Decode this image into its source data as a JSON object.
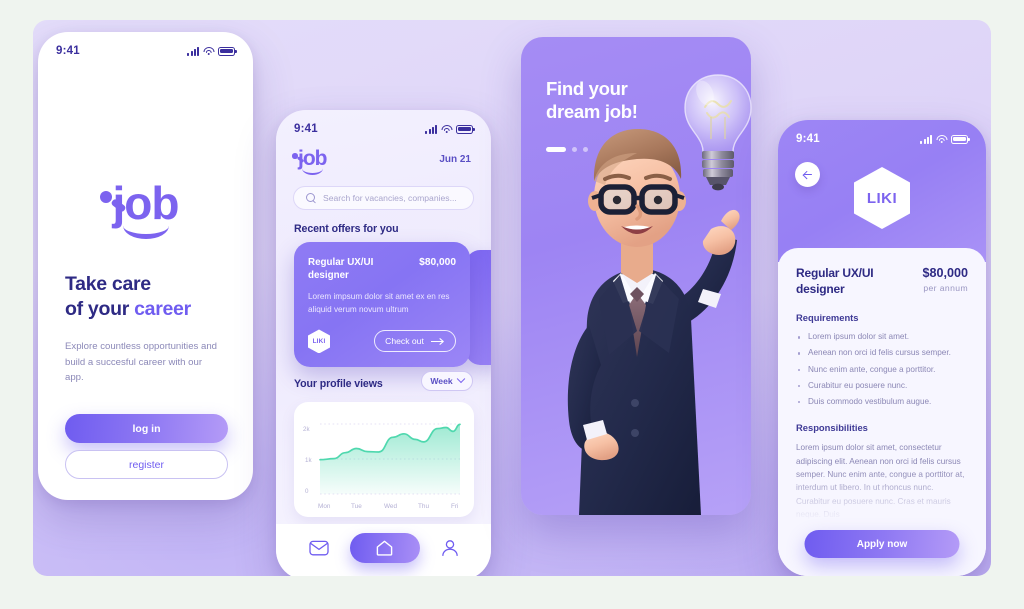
{
  "canvas": {
    "bg_accent": "#b9a9f2"
  },
  "brand": {
    "name": "job",
    "accent": "#7c63ef"
  },
  "phone_onboarding": {
    "status": {
      "time": "9:41",
      "signal": "signal-bars-icon",
      "wifi": "wifi-icon",
      "battery": "battery-icon"
    },
    "logo_text": "job",
    "headline_line1": "Take care",
    "headline_line2_prefix": "of your ",
    "headline_accent": "career",
    "subtitle": "Explore countless opportunities and build a succesful career with our app.",
    "login_label": "log in",
    "register_label": "register"
  },
  "phone_home": {
    "status": {
      "time": "9:41"
    },
    "logo_text": "job",
    "date": "Jun 21",
    "search": {
      "placeholder": "Search for vacancies, companies...",
      "icon": "search-icon"
    },
    "offers_title": "Recent offers for you",
    "offer_card": {
      "title": "Regular UX/UI designer",
      "salary": "$80,000",
      "description": "Lorem impsum dolor sit amet ex en res aliquid verum novum ultrum",
      "company_logo": "LIKI",
      "cta_label": "Check out",
      "cta_icon": "arrow-right-icon"
    },
    "views_title": "Your profile views",
    "range_label": "Week",
    "range_icon": "chevron-down-icon",
    "nav": {
      "mail": "mail-icon",
      "home": "home-icon",
      "profile": "profile-icon"
    }
  },
  "chart_data": {
    "type": "area",
    "title": "Your profile views",
    "xlabel": "",
    "ylabel": "",
    "categories": [
      "Mon",
      "Tue",
      "Wed",
      "Thu",
      "Fri"
    ],
    "x": [
      "Mon",
      "Tue",
      "Wed",
      "Thu",
      "Fri"
    ],
    "values": [
      1000,
      1250,
      1700,
      1500,
      1980
    ],
    "detail_points": [
      {
        "x": 0.0,
        "y": 980
      },
      {
        "x": 0.1,
        "y": 1010
      },
      {
        "x": 0.18,
        "y": 1180
      },
      {
        "x": 0.26,
        "y": 1300
      },
      {
        "x": 0.34,
        "y": 1210
      },
      {
        "x": 0.42,
        "y": 1200
      },
      {
        "x": 0.52,
        "y": 1620
      },
      {
        "x": 0.6,
        "y": 1720
      },
      {
        "x": 0.68,
        "y": 1560
      },
      {
        "x": 0.74,
        "y": 1490
      },
      {
        "x": 0.84,
        "y": 1870
      },
      {
        "x": 0.9,
        "y": 1900
      },
      {
        "x": 0.95,
        "y": 1790
      },
      {
        "x": 1.0,
        "y": 1990
      }
    ],
    "ylim": [
      0,
      2000
    ],
    "ytick_labels": [
      "2k",
      "1k",
      "0"
    ],
    "ytick_values": [
      2000,
      1000,
      0
    ],
    "grid": true,
    "legend": "none",
    "series_color": "#4fd8ae"
  },
  "promo": {
    "title_line1": "Find your",
    "title_line2": "dream job!",
    "dots": [
      {
        "active": true
      },
      {
        "active": false
      },
      {
        "active": false
      }
    ],
    "illustration": "businessman-with-lightbulb"
  },
  "phone_detail": {
    "status": {
      "time": "9:41"
    },
    "back_icon": "arrow-left-icon",
    "company_logo": "LIKI",
    "job_title": "Regular UX/UI designer",
    "salary": "$80,000",
    "salary_period": "per  annum",
    "requirements_heading": "Requirements",
    "requirements": [
      "Lorem ipsum dolor sit amet.",
      "Aenean non orci id felis cursus semper.",
      "Nunc enim ante, congue a porttitor.",
      "Curabitur eu posuere nunc.",
      "Duis commodo vestibulum augue."
    ],
    "responsibilities_heading": "Responsibilities",
    "responsibilities_body": "Lorem ipsum dolor sit amet, consectetur adipiscing elit. Aenean non orci id felis cursus semper. Nunc enim ante, congue a porttitor at, interdum ut libero. In ut rhoncus nunc. Curabitur eu posuere nunc. Cras et mauris neque. Duis",
    "apply_label": "Apply now"
  }
}
